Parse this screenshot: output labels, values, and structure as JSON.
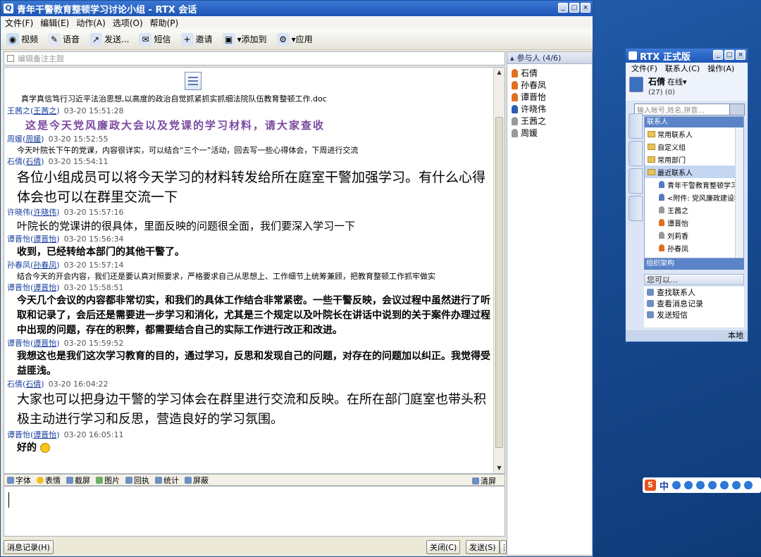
{
  "window": {
    "title": "青年干警教育整顿学习讨论小组 - RTX 会话"
  },
  "menu": [
    "文件(F)",
    "编辑(E)",
    "动作(A)",
    "选项(O)",
    "帮助(P)"
  ],
  "toolbar": [
    {
      "label": "视频",
      "icon": "video-icon"
    },
    {
      "label": "语音",
      "icon": "microphone-icon"
    },
    {
      "label": "发送...",
      "icon": "send-file-icon"
    },
    {
      "label": "短信",
      "icon": "sms-icon"
    },
    {
      "label": "邀请",
      "icon": "invite-icon"
    },
    {
      "label": "添加到",
      "icon": "add-to-icon"
    },
    {
      "label": "应用",
      "icon": "apps-icon"
    }
  ],
  "subject_placeholder": "编辑备注主题",
  "file": {
    "name": "真学真信笃行习近平法治思想,以高度的政治自觉抓紧抓实抓细法院队伍教育整顿工作.doc"
  },
  "messages": [
    {
      "name": "王茜之",
      "id": "王茜之",
      "time": "03-20 15:51:28",
      "text": "这是今天党风廉政大会以及党课的学习材料，请大家查收",
      "style": "m1"
    },
    {
      "name": "周媛",
      "id": "周媛",
      "time": "03-20 15:52:55",
      "text": "今天叶院长下午的党课，内容很详实，可以结合“三个一”活动，回去写一些心得体会，下周进行交流",
      "style": "msmall"
    },
    {
      "name": "石倩",
      "id": "石倩",
      "time": "03-20 15:54:11",
      "text": "各位小组成员可以将今天学习的材料转发给所在庭室干警加强学习。有什么心得体会也可以在群里交流一下",
      "style": "mbig"
    },
    {
      "name": "许晓伟",
      "id": "许晓伟",
      "time": "03-20 15:57:16",
      "text": "叶院长的党课讲的很具体，里面反映的问题很全面，我们要深入学习一下",
      "style": "mmed"
    },
    {
      "name": "谭晋怡",
      "id": "谭晋怡",
      "time": "03-20 15:56:34",
      "text": "收到，已经转给本部门的其他干警了。",
      "style": "mbold"
    },
    {
      "name": "孙春凤",
      "id": "孙春凤",
      "time": "03-20 15:57:14",
      "text": "结合今天的开会内容，我们还是要认真对照要求，严格要求自己从思想上、工作细节上统筹兼顾，把教育整顿工作抓牢做实",
      "style": "msmall"
    },
    {
      "name": "谭晋怡",
      "id": "谭晋怡",
      "time": "03-20 15:58:51",
      "text": "今天几个会议的内容都非常切实，和我们的具体工作结合非常紧密。一些干警反映，会议过程中虽然进行了听取和记录了，会后还是需要进一步学习和消化，尤其是三个规定以及叶院长在讲话中说到的关于案件办理过程中出现的问题，存在的积弊，都需要结合自己的实际工作进行改正和改进。",
      "style": "mbold"
    },
    {
      "name": "谭晋怡",
      "id": "谭晋怡",
      "time": "03-20 15:59:52",
      "text": "我想这也是我们这次学习教育的目的，通过学习，反思和发现自己的问题，对存在的问题加以纠正。我觉得受益匪浅。",
      "style": "mbold"
    },
    {
      "name": "石倩",
      "id": "石倩",
      "time": "03-20 16:04:22",
      "text": "大家也可以把身边干警的学习体会在群里进行交流和反映。在所在部门庭室也带头积极主动进行学习和反思，营造良好的学习氛围。",
      "style": "mbig2"
    },
    {
      "name": "谭晋怡",
      "id": "谭晋怡",
      "time": "03-20 16:05:11",
      "text": "好的",
      "style": "mbold"
    }
  ],
  "format_bar": [
    "字体",
    "表情",
    "截屏",
    "图片",
    "回执",
    "统计",
    "屏蔽"
  ],
  "format_clear": "清屏",
  "bottom": {
    "history": "消息记录(H)",
    "close": "关闭(C)",
    "send": "发送(S)"
  },
  "participants": {
    "header": "参与人 (4/6)",
    "list": [
      {
        "name": "石倩",
        "color": "#e07020"
      },
      {
        "name": "孙春凤",
        "color": "#e07020"
      },
      {
        "name": "谭晋怡",
        "color": "#e07020"
      },
      {
        "name": "许晓伟",
        "color": "#2a5fb8"
      },
      {
        "name": "王茜之",
        "color": "#999999"
      },
      {
        "name": "周媛",
        "color": "#999999"
      }
    ]
  },
  "rtx": {
    "title": "RTX 正式版",
    "menu": [
      "文件(F)",
      "联系人(C)",
      "操作(A)"
    ],
    "user": "石倩",
    "status": "在线",
    "counts": "(27)  (0)",
    "search_placeholder": "输入帐号,姓名,拼音...",
    "section": "联系人",
    "nodes": [
      {
        "label": "常用联系人",
        "kind": "folder",
        "sel": false
      },
      {
        "label": "自定义组",
        "kind": "folder",
        "sel": false
      },
      {
        "label": "常用部门",
        "kind": "folder",
        "sel": false
      },
      {
        "label": "最近联系人",
        "kind": "folder",
        "sel": true
      },
      {
        "label": "青年干警教育整顿学习",
        "kind": "group",
        "sel": false
      },
      {
        "label": "<附件: 党风廉政建设科",
        "kind": "group",
        "sel": false
      },
      {
        "label": "王茜之",
        "kind": "person-gray",
        "sel": false
      },
      {
        "label": "谭晋怡",
        "kind": "person",
        "sel": false
      },
      {
        "label": "刘莉香",
        "kind": "person-gray",
        "sel": false
      },
      {
        "label": "孙春凤",
        "kind": "person",
        "sel": false
      }
    ],
    "org": "组织架构",
    "can": "您可以...",
    "actions": [
      "查找联系人",
      "查看消息记录",
      "发送短信"
    ],
    "footer": "本地"
  }
}
